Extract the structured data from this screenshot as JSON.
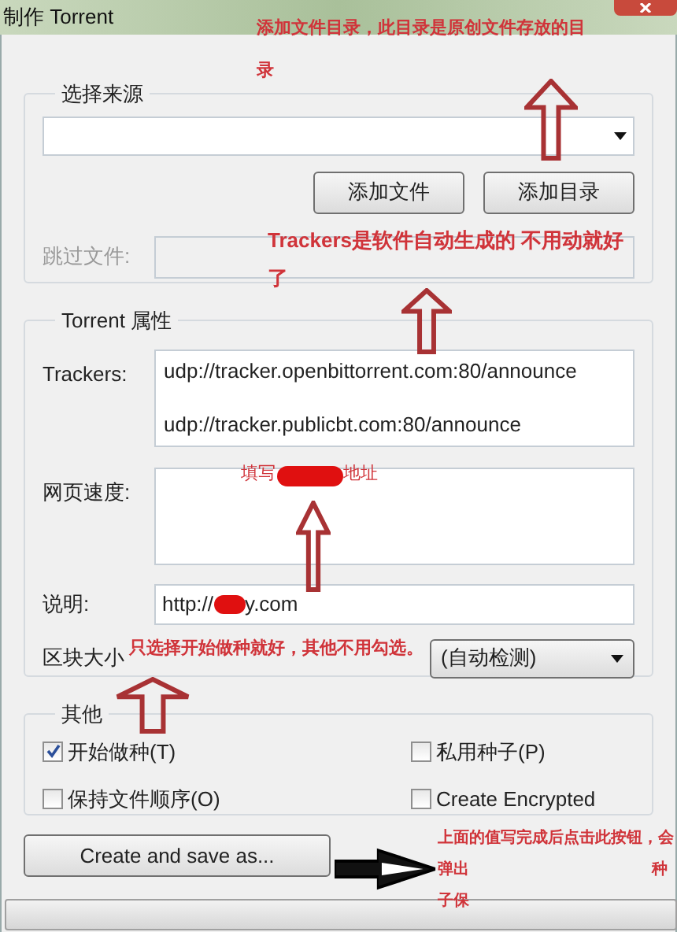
{
  "window": {
    "title": "制作 Torrent"
  },
  "source_group": {
    "title": "选择来源",
    "buttons": [
      "添加文件",
      "添加目录"
    ],
    "skip_label": "跳过文件:",
    "skip_disabled": true
  },
  "torrent_group": {
    "title": "Torrent 属性",
    "trackers_label": "Trackers:",
    "trackers": [
      "udp://tracker.openbittorrent.com:80/announce",
      "udp://tracker.publicbt.com:80/announce"
    ],
    "webseed_label": "网页速度:",
    "comment_label": "说明:",
    "comment_value_parts": [
      "http://",
      "y.com"
    ],
    "piece_label": "区块大小",
    "piece_value": "(自动检测)"
  },
  "other_group": {
    "title": "其他",
    "options": [
      {
        "label": "开始做种(T)",
        "checked": true
      },
      {
        "label": "私用种子(P)",
        "checked": false
      },
      {
        "label": "保持文件顺序(O)",
        "checked": false
      },
      {
        "label": "Create Encrypted",
        "checked": false
      }
    ]
  },
  "create_button": "Create and save as...",
  "progress": {
    "level": 0
  },
  "annotations": [
    {
      "text": "添加文件目录，此目录是原创文件存放的目"
    },
    {
      "text": "录"
    },
    {
      "text": "Trackers是软件自动生成的 不用动就好"
    },
    {
      "text": "了"
    },
    {
      "text": "填写"
    },
    {
      "text": "地址"
    },
    {
      "text": "只选择开始做种就好，其他不用勾选。"
    },
    {
      "text": "上面的值写完成后点击此按钮，会"
    },
    {
      "text": "弹出"
    },
    {
      "text": "种"
    },
    {
      "text": "子保"
    }
  ]
}
